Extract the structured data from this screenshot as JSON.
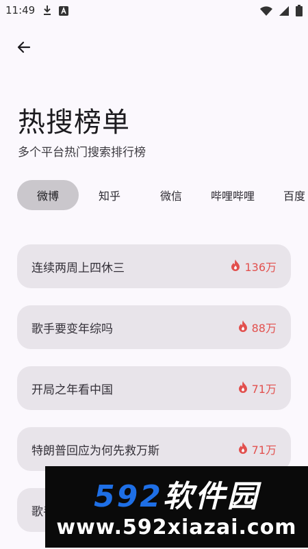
{
  "status_bar": {
    "time": "11:49",
    "icons_left": [
      "download-icon",
      "a-icon"
    ],
    "icons_right": [
      "wifi-icon",
      "signal-icon",
      "battery-icon"
    ]
  },
  "header": {
    "back_icon": "arrow-left-icon",
    "title": "热搜榜单",
    "subtitle": "多个平台热门搜索排行榜"
  },
  "tabs": [
    {
      "label": "微博",
      "active": true
    },
    {
      "label": "知乎",
      "active": false
    },
    {
      "label": "微信",
      "active": false
    },
    {
      "label": "哔哩哔哩",
      "active": false
    },
    {
      "label": "百度",
      "active": false
    }
  ],
  "list": [
    {
      "title": "连续两周上四休三",
      "heat": "136万"
    },
    {
      "title": "歌手要变年综吗",
      "heat": "88万"
    },
    {
      "title": "开局之年看中国",
      "heat": "71万"
    },
    {
      "title": "特朗普回应为何先救万斯",
      "heat": "71万"
    },
    {
      "title": "歌手",
      "heat": ""
    }
  ],
  "watermark": {
    "brand_number": "592",
    "brand_text": "软件园",
    "url": "www.592xiazai.com"
  },
  "colors": {
    "background": "#fbf8fd",
    "card": "#e8e4ea",
    "active_tab": "#cac7cc",
    "heat": "#e2504e"
  }
}
